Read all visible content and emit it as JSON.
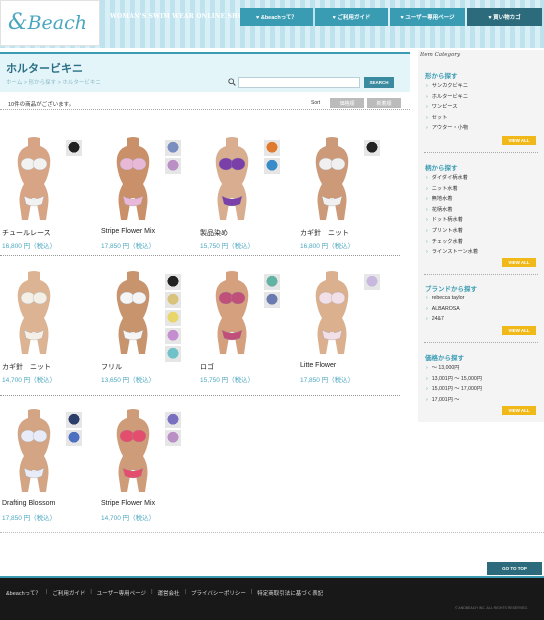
{
  "header": {
    "logo": "Beach",
    "logo_amp": "&",
    "tagline": "WOMAN'S SWIM WEAR ONLINE SHOP",
    "nav": [
      "♥ &beachって？",
      "♥ ご利用ガイド",
      "♥ ユーザー専用ページ",
      "♥ 買い物カゴ"
    ]
  },
  "page": {
    "title": "ホルタービキニ",
    "breadcrumb": "ホーム > 形から探す > ホルタービキニ",
    "search_placeholder": "",
    "search_button": "SEARCH",
    "count": "10件の商品がございます。",
    "sort_label": "Sort",
    "sort_options": [
      "価格順",
      "新着順"
    ]
  },
  "products": [
    {
      "name": "チュールレース",
      "price": "16,800 円（税込）",
      "colors": [
        "#222222"
      ]
    },
    {
      "name": "Stripe Flower Mix",
      "price": "17,850 円（税込）",
      "colors": [
        "#7a8fc0",
        "#b98fc6"
      ]
    },
    {
      "name": "製品染め",
      "price": "15,750 円（税込）",
      "colors": [
        "#e07a2e",
        "#3a8cc8"
      ]
    },
    {
      "name": "カギ針　ニット",
      "price": "16,800 円（税込）",
      "colors": [
        "#222222"
      ]
    },
    {
      "name": "カギ針　ニット",
      "price": "14,700 円（税込）",
      "colors": []
    },
    {
      "name": "フリル",
      "price": "13,650 円（税込）",
      "colors": [
        "#222222",
        "#d9c27a",
        "#e8d66a",
        "#c48ed0",
        "#6fc3c8"
      ]
    },
    {
      "name": "ロゴ",
      "price": "15,750 円（税込）",
      "colors": [
        "#63b3a4",
        "#6b7ab0"
      ]
    },
    {
      "name": "Litte Flower",
      "price": "17,850 円（税込）",
      "colors": [
        "#c8b8e0"
      ]
    },
    {
      "name": "Drafting Blossom",
      "price": "17,850 円（税込）",
      "colors": [
        "#2c3f6b",
        "#4d70c0"
      ]
    },
    {
      "name": "Stripe Flower Mix",
      "price": "14,700 円（税込）",
      "colors": [
        "#7a70c0",
        "#b98fc6"
      ]
    }
  ],
  "sidebar": {
    "heading": "Item Category",
    "view_all": "VIEW ALL",
    "sections": [
      {
        "title": "形から探す",
        "items": [
          "サンカクビキニ",
          "ホルタービキニ",
          "ワンピース",
          "セット",
          "アウター・小物"
        ]
      },
      {
        "title": "柄から探す",
        "items": [
          "ダイダイ柄水着",
          "ニット水着",
          "無地水着",
          "花柄水着",
          "ドット柄水着",
          "プリント水着",
          "チェック水着",
          "ラインストーン水着"
        ]
      },
      {
        "title": "ブランドから探す",
        "items": [
          "rebecca taylor",
          "ALBAROSA",
          "24&7"
        ]
      },
      {
        "title": "価格から探す",
        "items": [
          "〜 13,000円",
          "13,001円 〜 15,000円",
          "15,001円 〜 17,000円",
          "17,001円 〜"
        ]
      }
    ]
  },
  "footer": {
    "links": [
      "&beachって？",
      "ご利用ガイド",
      "ユーザー専用ページ",
      "運営会社",
      "プライバシーポリシー",
      "特定商取引法に基づく表記"
    ],
    "copyright": "© ANDBEACH INC. ALL RIGHTS RESERVED.",
    "go_to_top": "GO TO TOP"
  },
  "colors": {
    "accent": "#3a9cb3",
    "price": "#4aa6bf",
    "view_all": "#f0b919",
    "footer_bg": "#181818"
  }
}
